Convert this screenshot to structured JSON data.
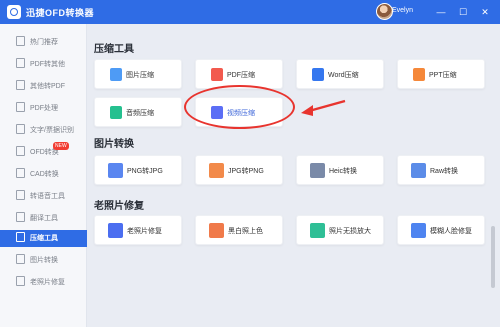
{
  "app": {
    "title": "迅捷OFD转换器",
    "username": "Evelyn",
    "win_minimize": "—",
    "win_maximize": "☐",
    "win_close": "✕"
  },
  "sidebar": {
    "items": [
      {
        "label": "热门推荐",
        "icon": "fire-icon"
      },
      {
        "label": "PDF转其他",
        "icon": "pdf-icon"
      },
      {
        "label": "其他转PDF",
        "icon": "convert-icon"
      },
      {
        "label": "PDF处理",
        "icon": "document-icon"
      },
      {
        "label": "文字/票据识别",
        "icon": "scan-icon"
      },
      {
        "label": "OFD转换",
        "icon": "ofd-icon",
        "badge": "NEW"
      },
      {
        "label": "CAD转换",
        "icon": "cad-icon"
      },
      {
        "label": "转语音工具",
        "icon": "speech-icon"
      },
      {
        "label": "翻译工具",
        "icon": "translate-icon"
      },
      {
        "label": "压缩工具",
        "icon": "compress-icon",
        "active": true
      },
      {
        "label": "图片转换",
        "icon": "image-icon"
      },
      {
        "label": "老照片修复",
        "icon": "photo-icon"
      }
    ]
  },
  "sections": [
    {
      "title": "压缩工具",
      "tools": [
        {
          "label": "图片压缩",
          "icon": "image-compress-icon",
          "color": "#4e9bf5"
        },
        {
          "label": "PDF压缩",
          "icon": "pdf-compress-icon",
          "color": "#f25a4e"
        },
        {
          "label": "Word压缩",
          "icon": "word-compress-icon",
          "color": "#3577ef"
        },
        {
          "label": "PPT压缩",
          "icon": "ppt-compress-icon",
          "color": "#f5883a"
        },
        {
          "label": "音频压缩",
          "icon": "audio-compress-icon",
          "color": "#25c08f"
        },
        {
          "label": "视频压缩",
          "icon": "video-compress-icon",
          "color": "#5b6ef5"
        }
      ]
    },
    {
      "title": "图片转换",
      "tools": [
        {
          "label": "PNG转JPG",
          "icon": "png-to-jpg-icon",
          "color": "#5a86f0"
        },
        {
          "label": "JPG转PNG",
          "icon": "jpg-to-png-icon",
          "color": "#f28a4a"
        },
        {
          "label": "Heic转换",
          "icon": "heic-icon",
          "color": "#7a8aa8"
        },
        {
          "label": "Raw转换",
          "icon": "raw-icon",
          "color": "#5b8ce8"
        }
      ]
    },
    {
      "title": "老照片修复",
      "tools": [
        {
          "label": "老照片修复",
          "icon": "old-photo-repair-icon",
          "color": "#4b6ef0"
        },
        {
          "label": "黑白照上色",
          "icon": "colorize-icon",
          "color": "#f07a4a"
        },
        {
          "label": "照片无损放大",
          "icon": "photo-enlarge-icon",
          "color": "#2fbf96"
        },
        {
          "label": "模糊人脸修复",
          "icon": "face-repair-icon",
          "color": "#4e84f0"
        }
      ]
    }
  ],
  "colors": {
    "accent": "#2f6ce5",
    "annotation": "#e8342e"
  }
}
